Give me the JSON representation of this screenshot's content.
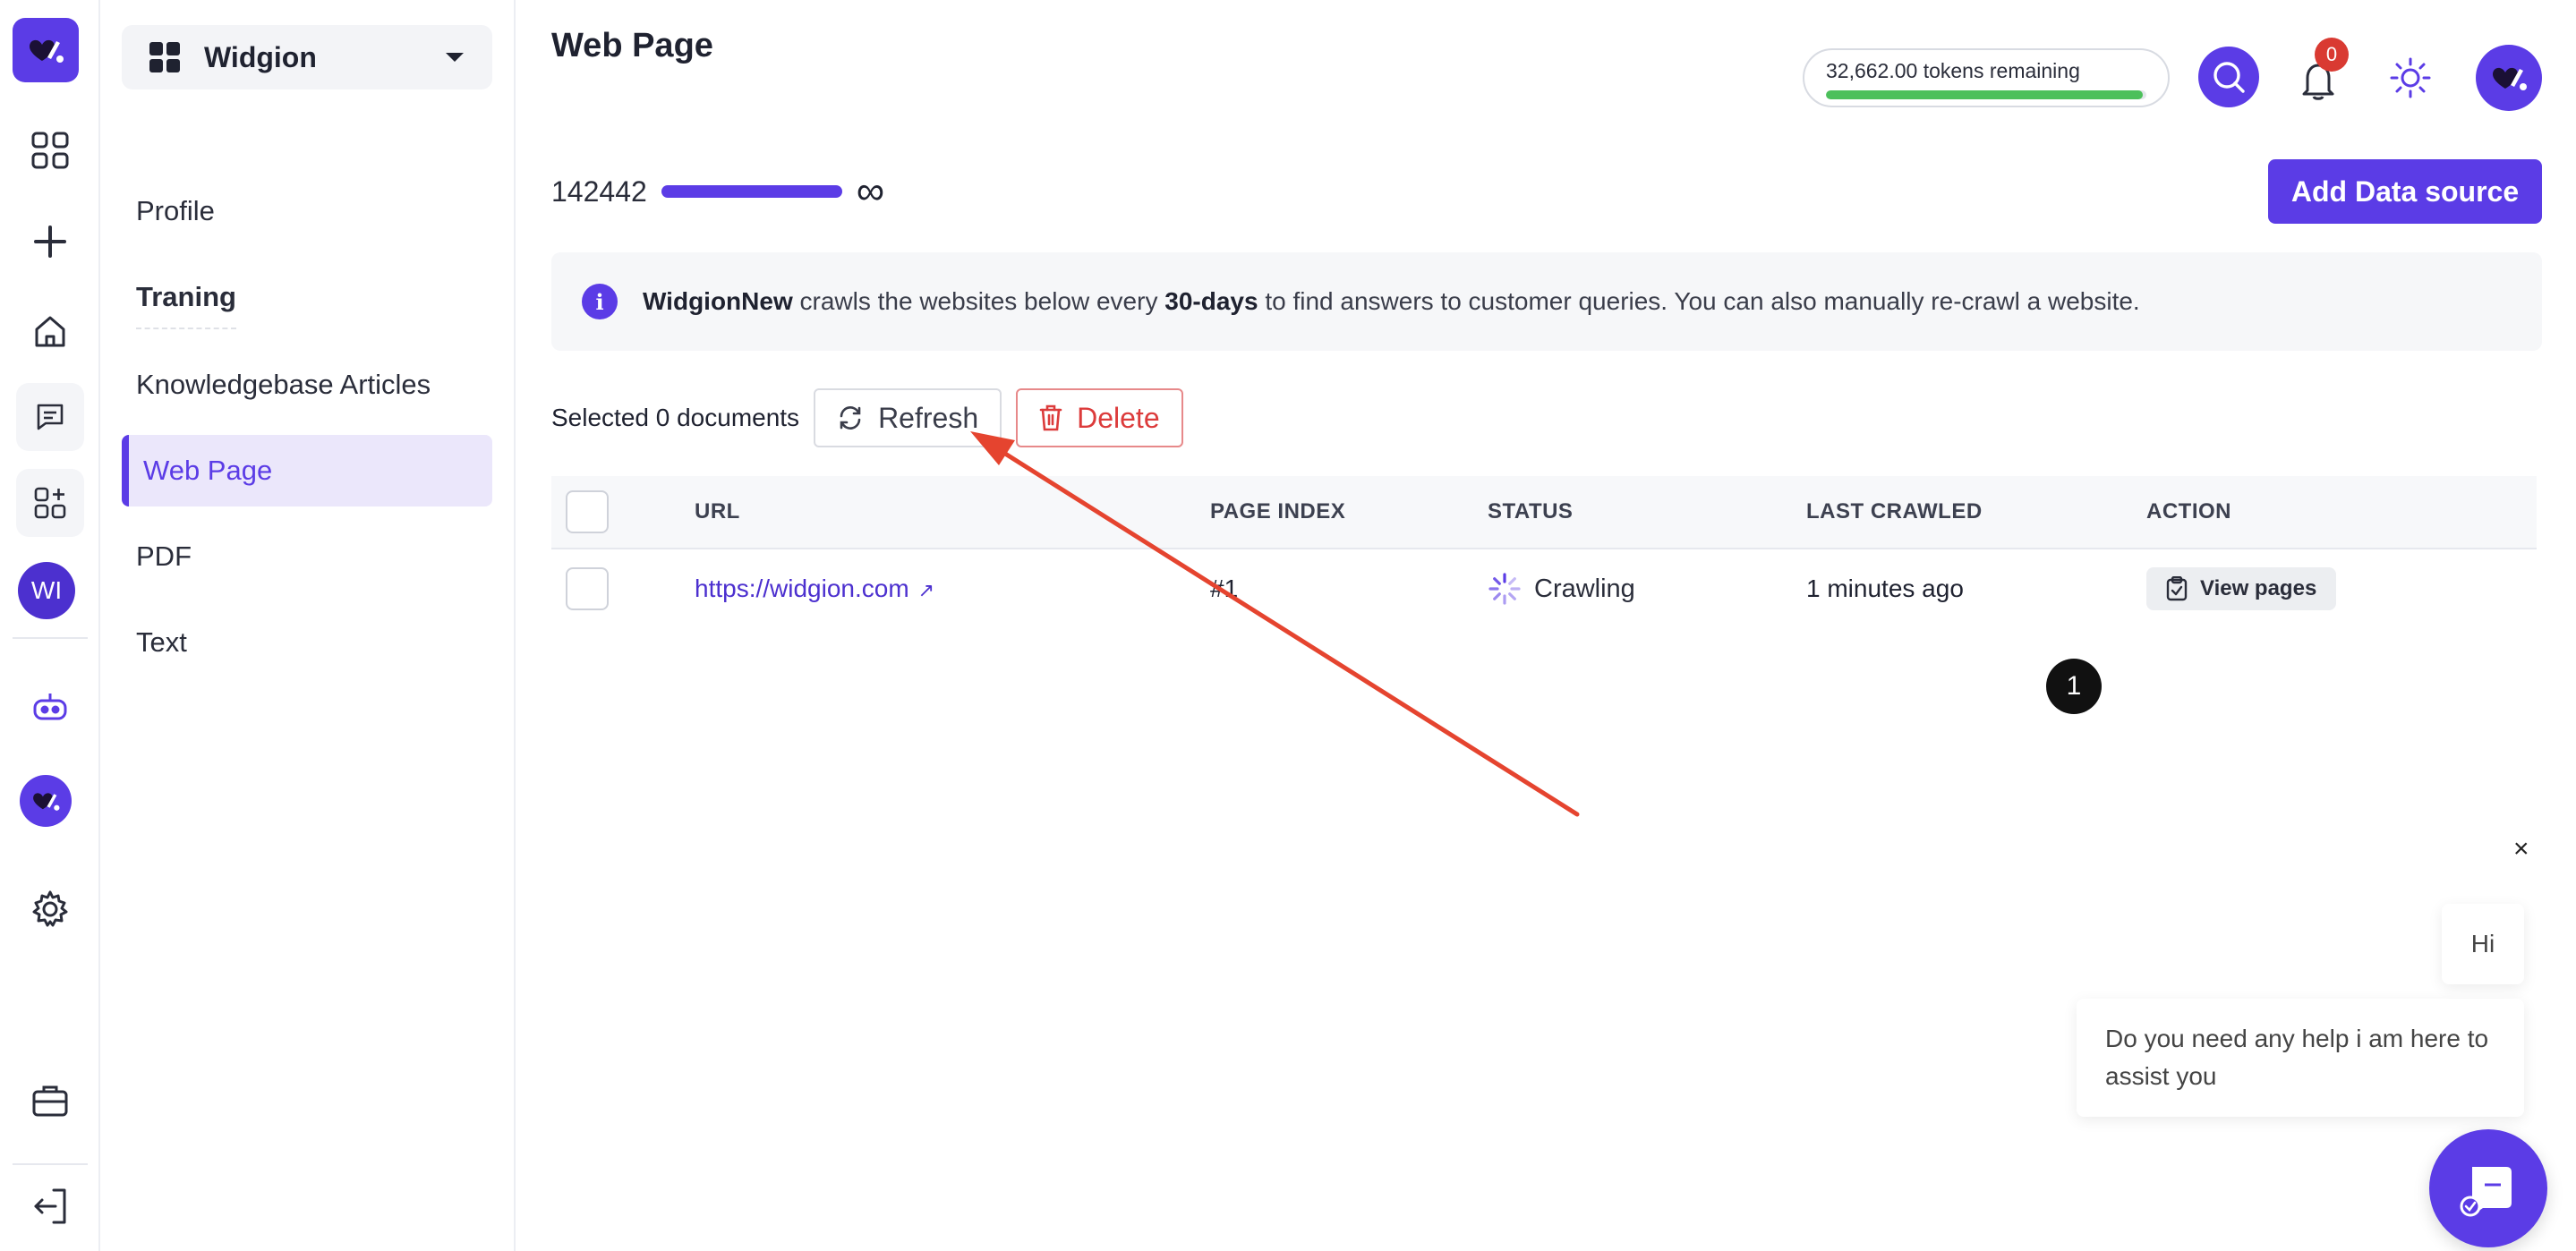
{
  "colors": {
    "accent": "#5b3ce6",
    "danger": "#dc3b3b",
    "success": "#4cc05b",
    "annotation": "#e5442f"
  },
  "rail": {
    "icons": [
      "widgion-logo-icon",
      "dashboard-grid-icon",
      "plus-icon",
      "home-icon",
      "chat-icon",
      "apps-add-icon",
      "bot-icon",
      "settings-gear-icon",
      "briefcase-icon",
      "logout-icon"
    ],
    "avatar_initials": "WI"
  },
  "sidebar": {
    "workspace_name": "Widgion",
    "items": [
      {
        "label": "Profile"
      },
      {
        "label": "Traning"
      },
      {
        "label": "Knowledgebase Articles"
      },
      {
        "label": "Web Page"
      },
      {
        "label": "PDF"
      },
      {
        "label": "Text"
      }
    ]
  },
  "header": {
    "title": "Web Page",
    "tokens_text": "32,662.00 tokens remaining",
    "tokens_fill_fraction": 0.99,
    "notification_count": "0"
  },
  "usage": {
    "count": "142442",
    "limit_symbol": "∞"
  },
  "actions": {
    "add_data_source": "Add Data source"
  },
  "info": {
    "brand": "WidgionNew",
    "text_a": " crawls the websites below every ",
    "period": "30-days",
    "text_b": " to find answers to customer queries. You can also manually re-crawl a website."
  },
  "toolbar": {
    "selected_text": "Selected 0 documents",
    "refresh_label": "Refresh",
    "delete_label": "Delete"
  },
  "table": {
    "columns": [
      "URL",
      "PAGE INDEX",
      "STATUS",
      "LAST CRAWLED",
      "ACTION"
    ],
    "rows": [
      {
        "url": "https://widgion.com",
        "page_index": "#1",
        "status": "Crawling",
        "last_crawled": "1 minutes ago",
        "action": "View pages"
      }
    ]
  },
  "annotation": {
    "step_number": "1"
  },
  "chat": {
    "close_symbol": "×",
    "greeting": "Hi",
    "message": "Do you need any help i am here to assist you"
  }
}
